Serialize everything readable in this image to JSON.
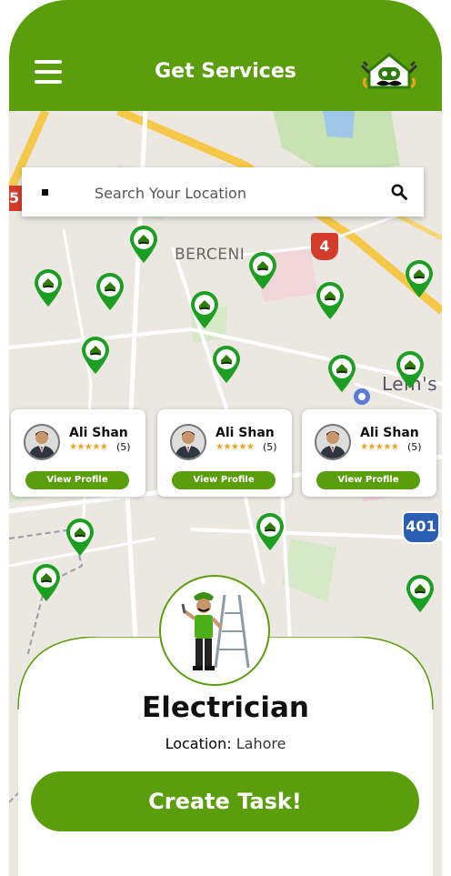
{
  "header": {
    "title": "Get Services",
    "menu_icon": "hamburger-menu-icon",
    "logo_icon": "handyman-logo-icon"
  },
  "search": {
    "placeholder": "Search Your Location",
    "icon": "search-icon"
  },
  "map": {
    "area_label": "BERCENI",
    "poi_label": "Lem's",
    "road_badges": [
      "4",
      "5",
      "401"
    ],
    "pin_icon": "worker-location-pin-icon"
  },
  "providers": [
    {
      "name": "Ali Shan",
      "stars": "★★★★★",
      "rating": "(5)",
      "button": "View Profile"
    },
    {
      "name": "Ali Shan",
      "stars": "★★★★★",
      "rating": "(5)",
      "button": "View Profile"
    },
    {
      "name": "Ali Shan",
      "stars": "★★★★★",
      "rating": "(5)",
      "button": "View Profile"
    }
  ],
  "service": {
    "title": "Electrician",
    "location_label": "Location:",
    "location_value": "Lahore",
    "image_icon": "electrician-with-ladder-icon"
  },
  "cta": {
    "label": "Create Task!"
  },
  "colors": {
    "brand_green": "#5a9e0c",
    "star": "#f2a31b",
    "road_red": "#d33b2b",
    "road_blue": "#2b5fb4"
  }
}
